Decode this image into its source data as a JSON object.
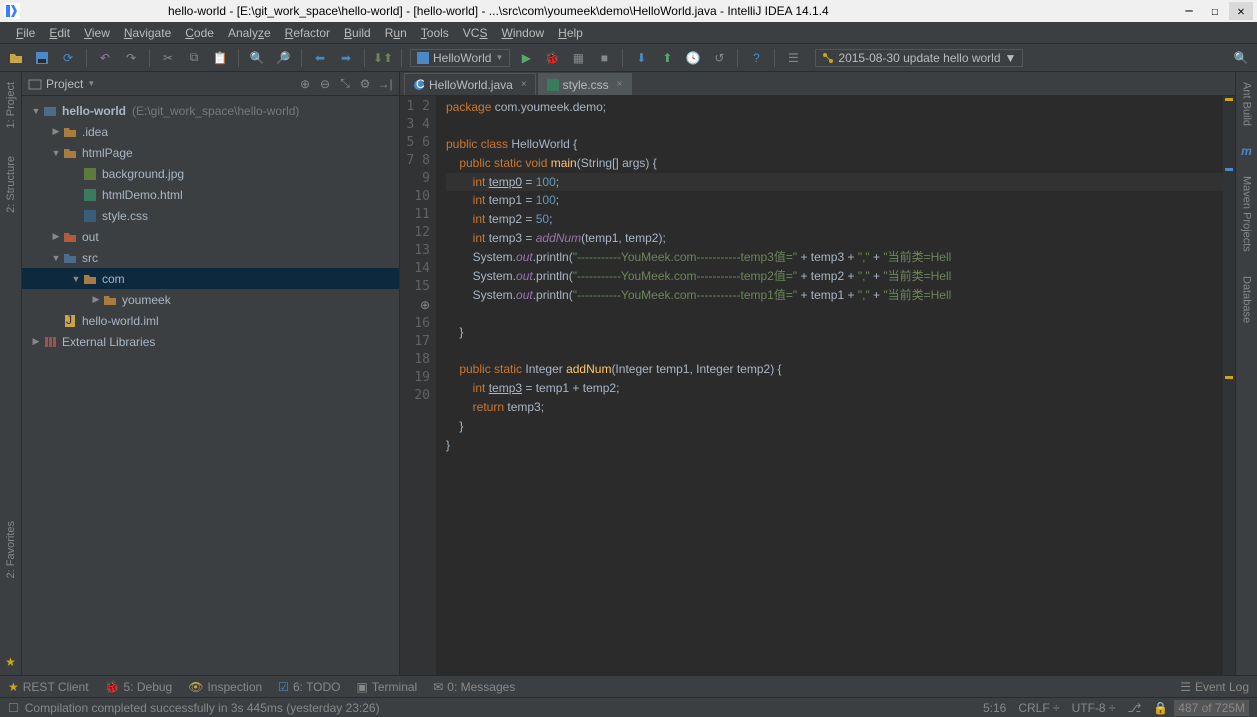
{
  "titlebar": {
    "title": "hello-world - [E:\\git_work_space\\hello-world] - [hello-world] - ...\\src\\com\\youmeek\\demo\\HelloWorld.java - IntelliJ IDEA 14.1.4"
  },
  "menubar": [
    "File",
    "Edit",
    "View",
    "Navigate",
    "Code",
    "Analyze",
    "Refactor",
    "Build",
    "Run",
    "Tools",
    "VCS",
    "Window",
    "Help"
  ],
  "toolbar": {
    "run_config": "HelloWorld",
    "vcs_label": "2015-08-30 update hello world"
  },
  "project": {
    "header": "Project",
    "root": {
      "name": "hello-world",
      "hint": "(E:\\git_work_space\\hello-world)"
    },
    "idea": ".idea",
    "htmlPage": "htmlPage",
    "files": {
      "bg": "background.jpg",
      "demo": "htmlDemo.html",
      "css": "style.css"
    },
    "out": "out",
    "src": "src",
    "com": "com",
    "youmeek": "youmeek",
    "iml": "hello-world.iml",
    "ext": "External Libraries"
  },
  "tabs": {
    "t1": "HelloWorld.java",
    "t2": "style.css"
  },
  "code": {
    "l1a": "package",
    "l1b": " com.youmeek.demo;",
    "l3a": "public class ",
    "l3b": "HelloWorld {",
    "l4a": "    public static void ",
    "l4b": "main",
    "l4c": "(String[] args) {",
    "l5a": "        int ",
    "l5b": "temp0",
    "l5c": " = ",
    "l5d": "100",
    "l5e": ";",
    "l6a": "        int ",
    "l6b": "temp1 = ",
    "l6c": "100",
    "l6d": ";",
    "l7a": "        int ",
    "l7b": "temp2 = ",
    "l7c": "50",
    "l7d": ";",
    "l8a": "        int ",
    "l8b": "temp3 = ",
    "l8c": "addNum",
    "l8d": "(temp1, temp2);",
    "l9a": "        System.",
    "l9b": "out",
    "l9c": ".println(",
    "l9d": "\"-----------YouMeek.com-----------temp3值=\"",
    "l9e": " + temp3 + ",
    "l9f": "\",\"",
    "l9g": " + ",
    "l9h": "\"当前类=Hell",
    "l10d": "\"-----------YouMeek.com-----------temp2值=\"",
    "l10e": " + temp2 + ",
    "l11d": "\"-----------YouMeek.com-----------temp1值=\"",
    "l11e": " + temp1 + ",
    "l13": "    }",
    "l15a": "    public static ",
    "l15b": "Integer ",
    "l15c": "addNum",
    "l15d": "(Integer temp1, Integer temp2) {",
    "l16a": "        int ",
    "l16b": "temp3",
    "l16c": " = temp1 + temp2;",
    "l17a": "        return ",
    "l17b": "temp3;",
    "l18": "    }",
    "l19": "}"
  },
  "bottom": {
    "rest": "REST Client",
    "debug": "5: Debug",
    "insp": "Inspection",
    "todo": "6: TODO",
    "term": "Terminal",
    "msg": "0: Messages",
    "evlog": "Event Log"
  },
  "status": {
    "msg": "Compilation completed successfully in 3s 445ms (yesterday 23:26)",
    "pos": "5:16",
    "crlf": "CRLF",
    "enc": "UTF-8",
    "mem": "487 of 725M"
  },
  "sidetabs": {
    "proj": "1: Project",
    "struct": "2: Structure",
    "fav": "2: Favorites",
    "ant": "Ant Build",
    "mvn": "Maven Projects",
    "db": "Database"
  }
}
